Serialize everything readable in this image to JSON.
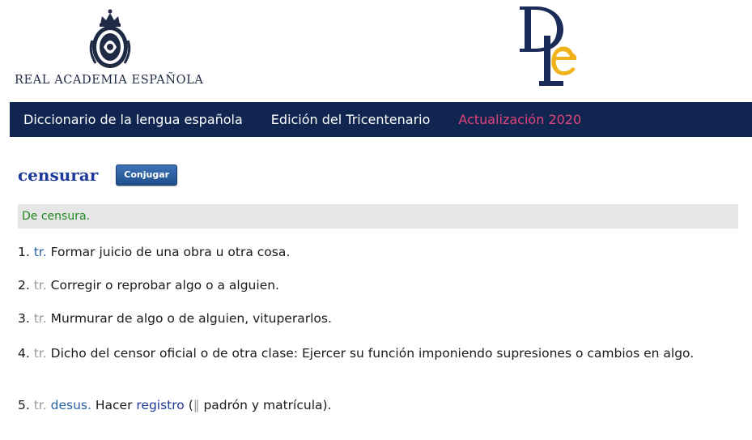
{
  "header": {
    "institution_name": "REAL ACADEMIA ESPAÑOLA",
    "crest_icon": "rae-crest-icon",
    "dle_logo_icon": "dle-logo-icon",
    "colors": {
      "navy": "#1a2b57",
      "gold": "#f0b21a"
    }
  },
  "navbar": {
    "background": "#10254f",
    "items": [
      {
        "label": "Diccionario de la lengua española"
      },
      {
        "label": "Edición del Tricentenario"
      },
      {
        "label": "Actualización 2020",
        "color": "#e3447a"
      }
    ]
  },
  "entry": {
    "lemma": "censurar",
    "conjugate_label": "Conjugar",
    "etymology": "De censura.",
    "senses": [
      {
        "number": "1.",
        "abbr": "tr.",
        "definition": "Formar juicio de una obra u otra cosa."
      },
      {
        "number": "2.",
        "abbr": "tr.",
        "definition": "Corregir o reprobar algo o a alguien."
      },
      {
        "number": "3.",
        "abbr": "tr.",
        "definition": "Murmurar de algo o de alguien, vituperarlos."
      },
      {
        "number": "4.",
        "abbr": "tr.",
        "definition": "Dicho del censor oficial o de otra clase: Ejercer su función imponiendo supresiones o cambios en algo."
      },
      {
        "number": "5.",
        "abbr": "tr.",
        "abbr2": "desus.",
        "definition_pre": "Hacer",
        "link": "registro",
        "paren_open": "(",
        "bars": "‖",
        "definition_post": "padrón y matrícula)."
      }
    ]
  }
}
